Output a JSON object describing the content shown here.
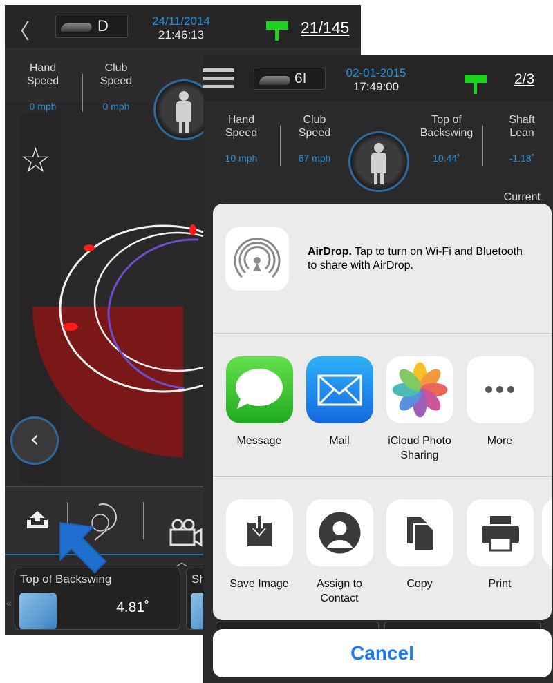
{
  "back_screen": {
    "back_chevron": "〈",
    "club": "D",
    "date": "24/11/2014",
    "time": "21:46:13",
    "swing_count": "21/145",
    "stats": [
      {
        "label_line1": "Hand",
        "label_line2": "Speed",
        "value": "0 mph"
      },
      {
        "label_line1": "Club",
        "label_line2": "Speed",
        "value": "0 mph"
      }
    ],
    "favorite_glyph": "☆",
    "prev_glyph": "‹",
    "expand_glyph": "︿",
    "side_glyph": "«",
    "tiles": [
      {
        "title": "Top of Backswing",
        "value": "4.81˚"
      },
      {
        "title": "Sh",
        "value": ""
      }
    ],
    "colors": {
      "accent_blue": "#1e90e0",
      "flag_green": "#19d31f",
      "zone_red": "#7a1717"
    }
  },
  "front_screen": {
    "club": "6I",
    "date": "02-01-2015",
    "time": "17:49:00",
    "swing_count": "2/3",
    "current_label": "Current",
    "stats": [
      {
        "label_line1": "Hand",
        "label_line2": "Speed",
        "value": "10 mph"
      },
      {
        "label_line1": "Club",
        "label_line2": "Speed",
        "value": "67 mph"
      },
      {
        "label_line1": "Top of",
        "label_line2": "Backswing",
        "value": "10.44˚"
      },
      {
        "label_line1": "Shaft",
        "label_line2": "Lean",
        "value": "-1.18˚"
      }
    ]
  },
  "share_sheet": {
    "airdrop_title": "AirDrop.",
    "airdrop_text": " Tap to turn on Wi-Fi and Bluetooth to share with AirDrop.",
    "apps": [
      {
        "label": "Message",
        "icon": "messages-icon"
      },
      {
        "label": "Mail",
        "icon": "mail-icon"
      },
      {
        "label": "iCloud Photo Sharing",
        "icon": "photos-icon"
      },
      {
        "label": "More",
        "icon": "more-icon"
      }
    ],
    "actions": [
      {
        "label": "Save Image",
        "icon": "save-image-icon"
      },
      {
        "label": "Assign to Contact",
        "icon": "contact-icon"
      },
      {
        "label": "Copy",
        "icon": "copy-icon"
      },
      {
        "label": "Print",
        "icon": "print-icon"
      }
    ],
    "cancel_label": "Cancel",
    "colors": {
      "ios_blue": "#1a7cf0",
      "sheet_bg": "#ebebeb"
    }
  }
}
